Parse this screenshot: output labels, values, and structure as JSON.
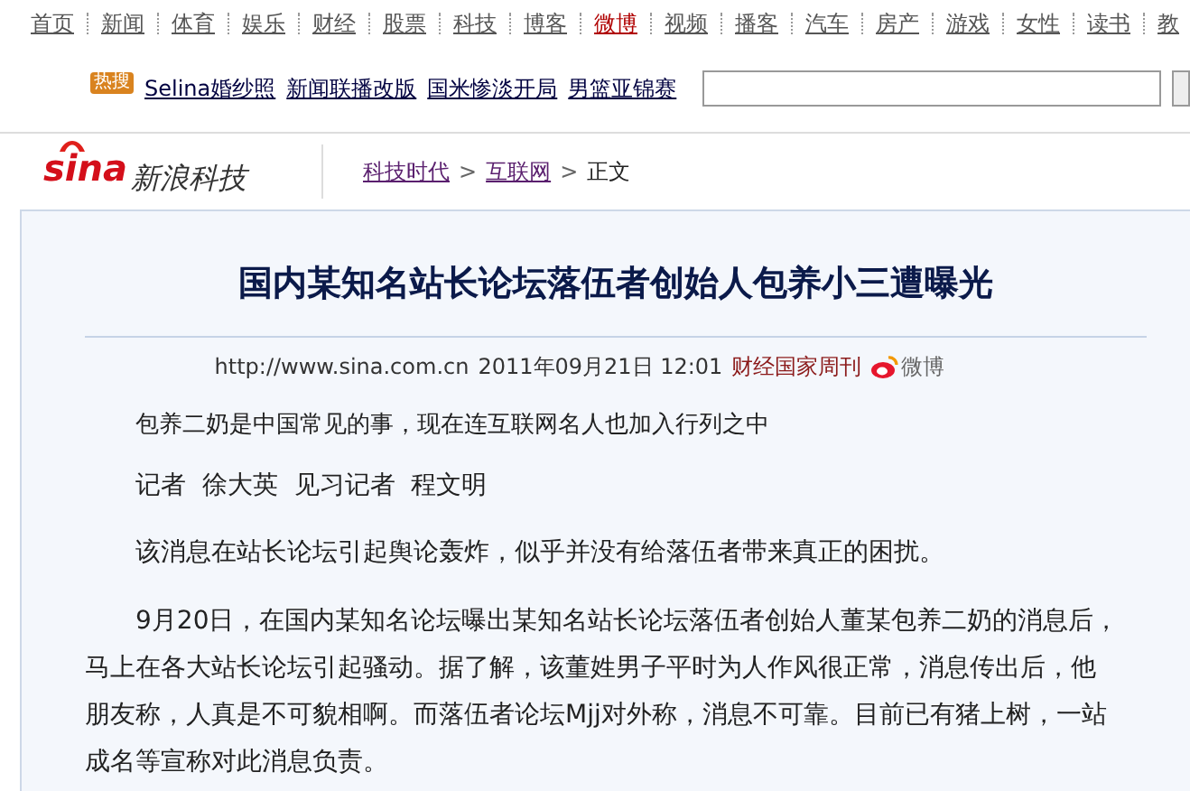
{
  "nav": [
    {
      "label": "首页",
      "selected": false
    },
    {
      "label": "新闻",
      "selected": false
    },
    {
      "label": "体育",
      "selected": false
    },
    {
      "label": "娱乐",
      "selected": false
    },
    {
      "label": "财经",
      "selected": false
    },
    {
      "label": "股票",
      "selected": false
    },
    {
      "label": "科技",
      "selected": false
    },
    {
      "label": "博客",
      "selected": false
    },
    {
      "label": "微博",
      "selected": true
    },
    {
      "label": "视频",
      "selected": false
    },
    {
      "label": "播客",
      "selected": false
    },
    {
      "label": "汽车",
      "selected": false
    },
    {
      "label": "房产",
      "selected": false
    },
    {
      "label": "游戏",
      "selected": false
    },
    {
      "label": "女性",
      "selected": false
    },
    {
      "label": "读书",
      "selected": false
    },
    {
      "label": "教",
      "selected": false
    }
  ],
  "hot": {
    "badge": "热搜",
    "links": [
      "Selina婚纱照",
      "新闻联播改版",
      "国米惨淡开局",
      "男篮亚锦赛"
    ]
  },
  "logo": {
    "brand": "sina",
    "section": "新浪科技"
  },
  "breadcrumb": {
    "separator": ">",
    "items": [
      {
        "label": "科技时代",
        "kind": "link"
      },
      {
        "label": "互联网",
        "kind": "link"
      },
      {
        "label": "正文",
        "kind": "text"
      }
    ]
  },
  "article": {
    "title": "国内某知名站长论坛落伍者创始人包养小三遭曝光",
    "url": "http://www.sina.com.cn",
    "date": "2011年09月21日 12:01",
    "source": "财经国家周刊",
    "weibo": "微博",
    "paragraphs": [
      {
        "kind": "summary",
        "text": "包养二奶是中国常见的事，现在连互联网名人也加入行列之中"
      },
      {
        "kind": "byline",
        "text": "记者  徐大英  见习记者  程文明"
      },
      {
        "kind": "body",
        "text": "该消息在站长论坛引起舆论轰炸，似乎并没有给落伍者带来真正的困扰。"
      },
      {
        "kind": "lead",
        "text": "9月20日，在国内某知名论坛曝出某知名站长论坛落伍者创始人董某包养二奶的消息后，马上在各大站长论坛引起骚动。据了解，该董姓男子平时为人作风很正常，消息传出后，他朋友称，人真是不可貌相啊。而落伍者论坛Mjj对外称，消息不可靠。目前已有猪上树，一站成名等宣称对此消息负责。"
      }
    ]
  }
}
